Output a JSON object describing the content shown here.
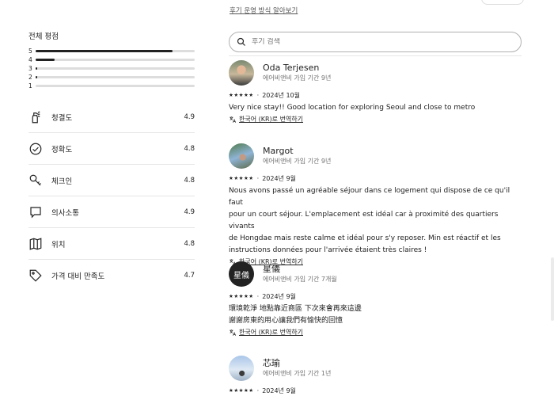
{
  "header": {
    "policy_link": "후기 운영 방식 알아보기"
  },
  "overall": {
    "title": "전체 평점",
    "bars": [
      {
        "label": "5",
        "fraction": 0.86
      },
      {
        "label": "4",
        "fraction": 0.12
      },
      {
        "label": "3",
        "fraction": 0.01
      },
      {
        "label": "2",
        "fraction": 0.01
      },
      {
        "label": "1",
        "fraction": 0.0
      }
    ]
  },
  "categories": [
    {
      "label": "청결도",
      "score": "4.9",
      "icon": "spray-bottle-icon"
    },
    {
      "label": "정확도",
      "score": "4.8",
      "icon": "check-circle-icon"
    },
    {
      "label": "체크인",
      "score": "4.8",
      "icon": "key-icon"
    },
    {
      "label": "의사소통",
      "score": "4.9",
      "icon": "chat-bubble-icon"
    },
    {
      "label": "위치",
      "score": "4.8",
      "icon": "map-icon"
    },
    {
      "label": "가격 대비 만족도",
      "score": "4.7",
      "icon": "price-tag-icon"
    }
  ],
  "search": {
    "placeholder": "후기 검색"
  },
  "reviews": [
    {
      "name": "Oda Terjesen",
      "tenure": "에어비앤비 가입 기간 9년",
      "stars": "★★★★★",
      "date": "2024년 10월",
      "body": [
        "Very nice stay!! Good location for exploring Seoul and close to metro"
      ],
      "translate": "한국어 (KR)로 번역하기"
    },
    {
      "name": "Margot",
      "tenure": "에어비앤비 가입 기간 9년",
      "stars": "★★★★★",
      "date": "2024년 9월",
      "body": [
        "Nous avons passé un agréable séjour dans ce logement qui dispose de ce qu'il faut",
        "pour un court séjour. L'emplacement est idéal car à proximité des quartiers vivants",
        "de Hongdae mais reste calme et idéal pour s'y reposer. Min est réactif et les",
        "instructions données pour l'arrivée étaient très claires !"
      ],
      "translate": "한국어 (KR)로 번역하기"
    },
    {
      "name": "星儀",
      "avatar_text": "星儀",
      "tenure": "에어비앤비 가입 기간 7개월",
      "stars": "★★★★★",
      "date": "2024년 9월",
      "body": [
        "環境乾淨 地點靠近商區 下次來會再來這邊",
        "謝謝房東的用心讓我們有愉快的回憶"
      ],
      "translate": "한국어 (KR)로 번역하기"
    },
    {
      "name": "芯瑜",
      "tenure": "에어비앤비 가입 기간 1년",
      "stars": "★★★★★",
      "date": "2024년 9월"
    }
  ]
}
